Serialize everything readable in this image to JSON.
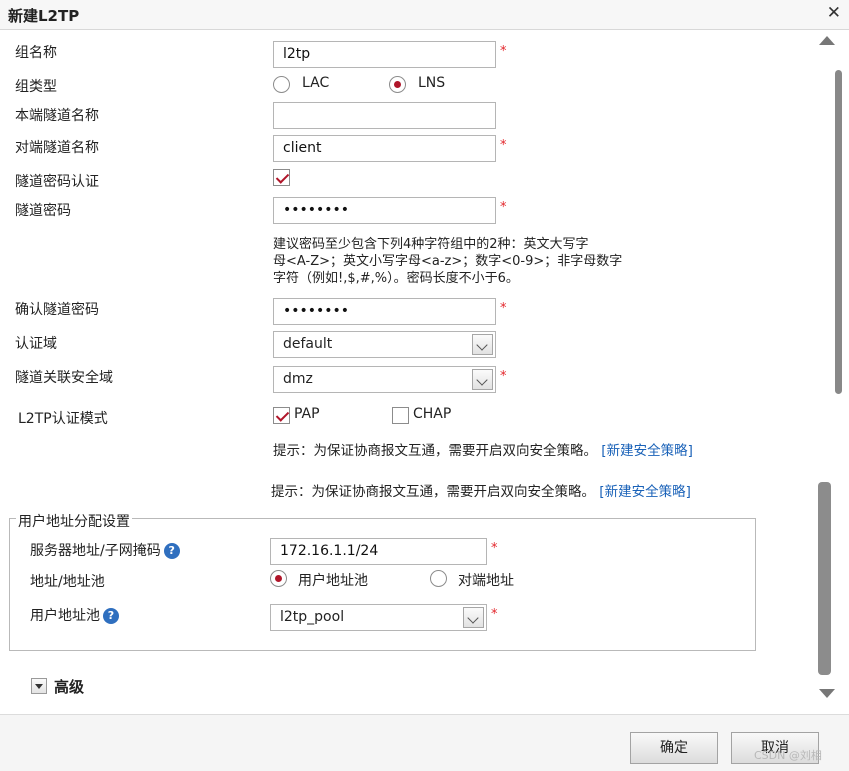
{
  "dialog": {
    "title": "新建L2TP",
    "close_icon": "close-icon"
  },
  "form": {
    "group_name": {
      "label": "组名称",
      "value": "l2tp"
    },
    "group_type": {
      "label": "组类型",
      "options": [
        "LAC",
        "LNS"
      ],
      "selected": "LNS"
    },
    "local_tunnel_name": {
      "label": "本端隧道名称",
      "value": ""
    },
    "peer_tunnel_name": {
      "label": "对端隧道名称",
      "value": "client"
    },
    "tunnel_password_auth": {
      "label": "隧道密码认证",
      "checked": true
    },
    "tunnel_password": {
      "label": "隧道密码",
      "value": "••••••••",
      "hint_line1": "建议密码至少包含下列4种字符组中的2种：英文大写字",
      "hint_line2": "母<A-Z>；英文小写字母<a-z>；数字<0-9>；非字母数字",
      "hint_line3": "字符（例如!,$,#,%）。密码长度不小于6。"
    },
    "confirm_tunnel_password": {
      "label": "确认隧道密码",
      "value": "••••••••"
    },
    "auth_domain": {
      "label": "认证域",
      "value": "default"
    },
    "tunnel_security_zone": {
      "label": "隧道关联安全域",
      "value": "dmz"
    },
    "l2tp_auth_mode": {
      "label": "L2TP认证模式",
      "pap": "PAP",
      "pap_checked": true,
      "chap": "CHAP",
      "chap_checked": false
    },
    "security_hint": {
      "text": "提示：为保证协商报文互通，需要开启双向安全策略。",
      "link": "[新建安全策略]"
    },
    "security_hint_dup": {
      "text": "提示：为保证协商报文互通，需要开启双向安全策略。",
      "link": "[新建安全策略]"
    }
  },
  "user_address": {
    "legend": "用户地址分配设置",
    "server_addr": {
      "label": "服务器地址/子网掩码",
      "value": "172.16.1.1/24"
    },
    "addr_mode": {
      "label": "地址/地址池",
      "options": [
        "用户地址池",
        "对端地址"
      ],
      "selected": "用户地址池"
    },
    "pool": {
      "label": "用户地址池",
      "value": "l2tp_pool"
    },
    "help_icon": "?"
  },
  "advanced": {
    "label": "高级"
  },
  "footer": {
    "ok": "确定",
    "cancel": "取消",
    "watermark": "CSDN @刘相"
  },
  "required_mark": "*"
}
